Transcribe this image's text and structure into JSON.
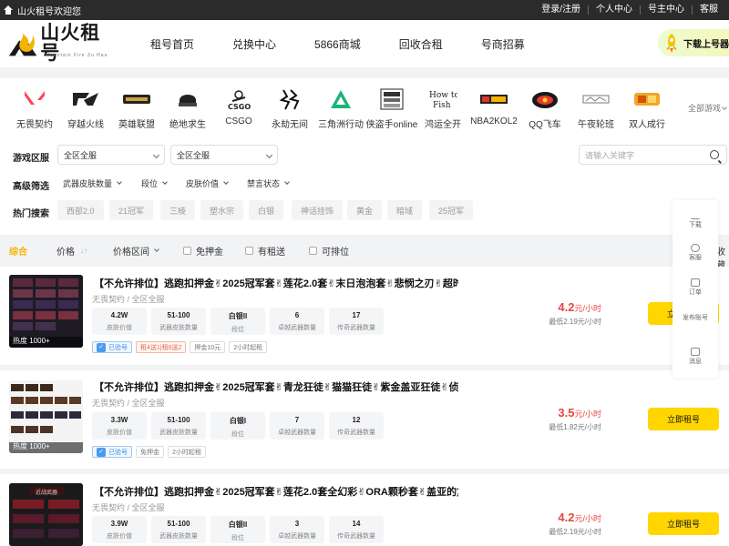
{
  "topbar": {
    "welcome": "山火租号欢迎您",
    "links": [
      "登录/注册",
      "个人中心",
      "号主中心",
      "客服"
    ]
  },
  "header": {
    "logo_text": "山火租号",
    "logo_sub": "Mountain Fire Zu Hao",
    "nav": [
      "租号首页",
      "兑换中心",
      "5866商城",
      "回收合租",
      "号商招募"
    ],
    "download_label": "下载上号器"
  },
  "games": [
    {
      "name": "无畏契约",
      "icon": "valorant-icon"
    },
    {
      "name": "穿越火线",
      "icon": "crossfire-icon"
    },
    {
      "name": "英雄联盟",
      "icon": "lol-icon"
    },
    {
      "name": "绝地求生",
      "icon": "pubg-icon"
    },
    {
      "name": "CSGO",
      "icon": "csgo-icon"
    },
    {
      "name": "永劫无间",
      "icon": "naraka-icon"
    },
    {
      "name": "三角洲行动",
      "icon": "delta-force-icon"
    },
    {
      "name": "侠盗手online",
      "icon": "gta-icon"
    },
    {
      "name": "鸿运全开",
      "icon": "howtofish-icon"
    },
    {
      "name": "NBA2KOL2",
      "icon": "nba2k-icon"
    },
    {
      "name": "QQ飞车",
      "icon": "qqspeed-icon"
    },
    {
      "name": "午夜轮班",
      "icon": "midnight-icon"
    },
    {
      "name": "双人成行",
      "icon": "ittakestwo-icon"
    }
  ],
  "all_games_label": "全部游戏",
  "filters": {
    "region_label": "游戏区服",
    "region_select_1": "全区全服",
    "region_select_2": "全区全服",
    "search_placeholder": "请输入关键字",
    "advanced_label": "高级筛选",
    "advanced_options": [
      "武器皮肤数量",
      "段位",
      "皮肤价值",
      "禁言状态"
    ],
    "hot_label": "热门搜索",
    "hot_tags": [
      "西部2.0",
      "21冠军",
      "三棱",
      "塑水宗",
      "白银",
      "神话挂饰",
      "黄金",
      "暗域",
      "25冠军"
    ]
  },
  "sortbar": {
    "items": [
      "综合",
      "价格",
      "价格区间"
    ],
    "checkboxes": [
      "免押金",
      "有租送",
      "可排位"
    ],
    "right_label": "收藏"
  },
  "listings": [
    {
      "title": "【不允许排位】逃跑扣押金✌2025冠军套✌莲花2.0套✌末日泡泡套✌悲悯之刃✌超时...",
      "subtitle": "无畏契约 / 全区全服",
      "stats": [
        {
          "value": "4.2W",
          "label": "皮肤价值"
        },
        {
          "value": "51-100",
          "label": "武器皮肤数量"
        },
        {
          "value": "白银II",
          "label": "段位"
        },
        {
          "value": "6",
          "label": "卓越武器数量"
        },
        {
          "value": "17",
          "label": "传奇武器数量"
        }
      ],
      "tags": [
        "已验号",
        "租4送1|租6送2",
        "押金10元",
        "2小时起租"
      ],
      "price": "4.2",
      "price_unit": "元/小时",
      "min_price": "最低2.19元/小时",
      "hot": "热度 1000+",
      "button": "立即租号"
    },
    {
      "title": "【不允许排位】逃跑扣押金✌2025冠军套✌青龙狂徒✌猫猫狂徒✌紫金盖亚狂徒✌侦察...",
      "subtitle": "无畏契约 / 全区全服",
      "stats": [
        {
          "value": "3.3W",
          "label": "皮肤价值"
        },
        {
          "value": "51-100",
          "label": "武器皮肤数量"
        },
        {
          "value": "白银I",
          "label": "段位"
        },
        {
          "value": "7",
          "label": "卓越武器数量"
        },
        {
          "value": "12",
          "label": "传奇武器数量"
        }
      ],
      "tags": [
        "已验号",
        "免押金",
        "2小时起租"
      ],
      "price": "3.5",
      "price_unit": "元/小时",
      "min_price": "最低1.82元/小时",
      "hot": "热度 1000+",
      "button": "立即租号"
    },
    {
      "title": "【不允许排位】逃跑扣押金✌2025冠军套✌莲花2.0套全幻彩✌ORA颗秒套✌盖亚的复...",
      "subtitle": "无畏契约 / 全区全服",
      "stats": [
        {
          "value": "3.9W",
          "label": "皮肤价值"
        },
        {
          "value": "51-100",
          "label": "武器皮肤数量"
        },
        {
          "value": "白银II",
          "label": "段位"
        },
        {
          "value": "3",
          "label": "卓越武器数量"
        },
        {
          "value": "14",
          "label": "传奇武器数量"
        }
      ],
      "tags": [],
      "price": "4.2",
      "price_unit": "元/小时",
      "min_price": "最低2.19元/小时",
      "thumb_label": "近战武器",
      "button": "立即租号"
    }
  ],
  "sidepanel": [
    "下载",
    "客服",
    "订单",
    "发布账号",
    "消息"
  ],
  "colors": {
    "accent": "#ffd600",
    "price": "#e8463c",
    "sort_active": "#f5b400",
    "topbar_bg": "#2b2b2b"
  }
}
